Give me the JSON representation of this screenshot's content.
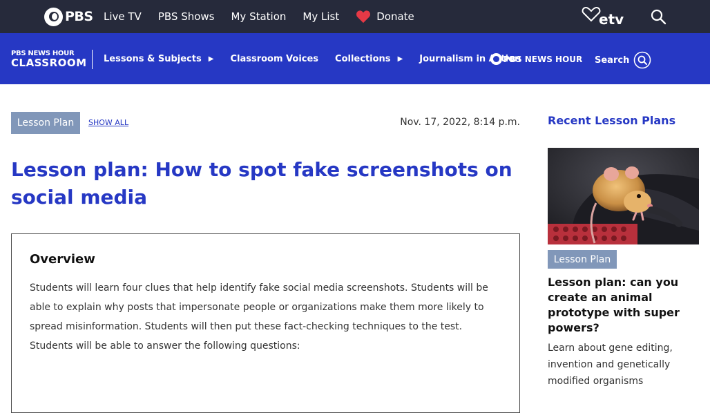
{
  "topbar": {
    "logo_text": "PBS",
    "nav": [
      "Live TV",
      "PBS Shows",
      "My Station",
      "My List"
    ],
    "donate_label": "Donate",
    "station_logo": "etv",
    "icons": {
      "search": "search-icon",
      "donate": "heart-icon"
    }
  },
  "classroom_nav": {
    "logo_line1": "PBS NEWS HOUR",
    "logo_line2": "CLASSROOM",
    "items": [
      {
        "label": "Lessons & Subjects",
        "arrow": "▶"
      },
      {
        "label": "Classroom Voices",
        "arrow": ""
      },
      {
        "label": "Collections",
        "arrow": "▶"
      },
      {
        "label": "Journalism in Action",
        "arrow": ""
      }
    ],
    "newshour_logo": "PBS NEWS HOUR",
    "search_label": "Search"
  },
  "article": {
    "category": "Lesson Plan",
    "show_all": "SHOW ALL",
    "date": "Nov. 17, 2022, 8:14 p.m.",
    "title": "Lesson plan: How to spot fake screenshots on social media",
    "overview_heading": "Overview",
    "overview_text": "Students will learn four clues that help identify fake social media screenshots. Students will be able to explain why posts that impersonate people or organizations make them more likely to spread misinformation. Students will then put these fact-checking techniques to the test. Students will be able to answer the following questions:"
  },
  "sidebar": {
    "heading": "Recent Lesson Plans",
    "card": {
      "category": "Lesson Plan",
      "title": "Lesson plan: can you create an animal prototype with super powers?",
      "description": "Learn about gene editing, invention and genetically modified organisms"
    }
  },
  "colors": {
    "topbar": "#262a3b",
    "brand_blue": "#2638c4",
    "badge": "#8197b9",
    "donate_heart": "#e63946"
  }
}
